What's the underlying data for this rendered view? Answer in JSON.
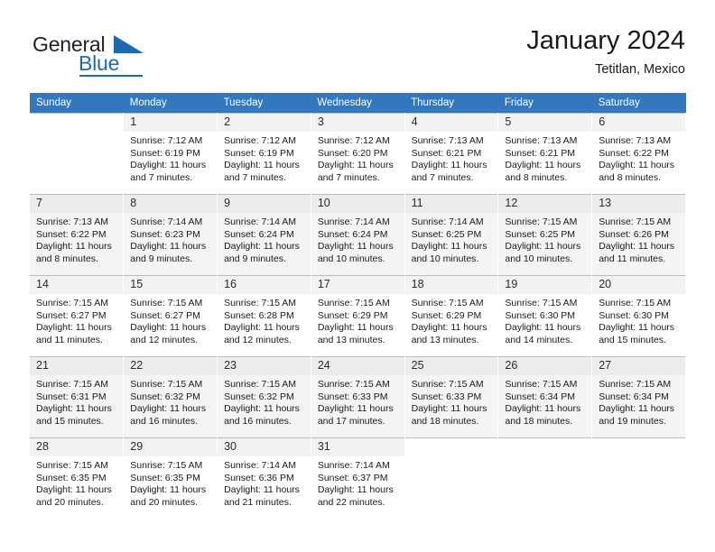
{
  "logo": {
    "word1": "General",
    "word2": "Blue",
    "triangle_color": "#1f69b0",
    "text_color": "#231f20"
  },
  "header": {
    "title": "January 2024",
    "subtitle": "Tetitlan, Mexico",
    "header_bg": "#3377bd"
  },
  "weekdays": [
    "Sunday",
    "Monday",
    "Tuesday",
    "Wednesday",
    "Thursday",
    "Friday",
    "Saturday"
  ],
  "weeks": [
    [
      {
        "day": "",
        "lines": [
          "",
          "",
          "",
          ""
        ]
      },
      {
        "day": "1",
        "lines": [
          "Sunrise: 7:12 AM",
          "Sunset: 6:19 PM",
          "Daylight: 11 hours",
          "and 7 minutes."
        ]
      },
      {
        "day": "2",
        "lines": [
          "Sunrise: 7:12 AM",
          "Sunset: 6:19 PM",
          "Daylight: 11 hours",
          "and 7 minutes."
        ]
      },
      {
        "day": "3",
        "lines": [
          "Sunrise: 7:12 AM",
          "Sunset: 6:20 PM",
          "Daylight: 11 hours",
          "and 7 minutes."
        ]
      },
      {
        "day": "4",
        "lines": [
          "Sunrise: 7:13 AM",
          "Sunset: 6:21 PM",
          "Daylight: 11 hours",
          "and 7 minutes."
        ]
      },
      {
        "day": "5",
        "lines": [
          "Sunrise: 7:13 AM",
          "Sunset: 6:21 PM",
          "Daylight: 11 hours",
          "and 8 minutes."
        ]
      },
      {
        "day": "6",
        "lines": [
          "Sunrise: 7:13 AM",
          "Sunset: 6:22 PM",
          "Daylight: 11 hours",
          "and 8 minutes."
        ]
      }
    ],
    [
      {
        "day": "7",
        "lines": [
          "Sunrise: 7:13 AM",
          "Sunset: 6:22 PM",
          "Daylight: 11 hours",
          "and 8 minutes."
        ]
      },
      {
        "day": "8",
        "lines": [
          "Sunrise: 7:14 AM",
          "Sunset: 6:23 PM",
          "Daylight: 11 hours",
          "and 9 minutes."
        ]
      },
      {
        "day": "9",
        "lines": [
          "Sunrise: 7:14 AM",
          "Sunset: 6:24 PM",
          "Daylight: 11 hours",
          "and 9 minutes."
        ]
      },
      {
        "day": "10",
        "lines": [
          "Sunrise: 7:14 AM",
          "Sunset: 6:24 PM",
          "Daylight: 11 hours",
          "and 10 minutes."
        ]
      },
      {
        "day": "11",
        "lines": [
          "Sunrise: 7:14 AM",
          "Sunset: 6:25 PM",
          "Daylight: 11 hours",
          "and 10 minutes."
        ]
      },
      {
        "day": "12",
        "lines": [
          "Sunrise: 7:15 AM",
          "Sunset: 6:25 PM",
          "Daylight: 11 hours",
          "and 10 minutes."
        ]
      },
      {
        "day": "13",
        "lines": [
          "Sunrise: 7:15 AM",
          "Sunset: 6:26 PM",
          "Daylight: 11 hours",
          "and 11 minutes."
        ]
      }
    ],
    [
      {
        "day": "14",
        "lines": [
          "Sunrise: 7:15 AM",
          "Sunset: 6:27 PM",
          "Daylight: 11 hours",
          "and 11 minutes."
        ]
      },
      {
        "day": "15",
        "lines": [
          "Sunrise: 7:15 AM",
          "Sunset: 6:27 PM",
          "Daylight: 11 hours",
          "and 12 minutes."
        ]
      },
      {
        "day": "16",
        "lines": [
          "Sunrise: 7:15 AM",
          "Sunset: 6:28 PM",
          "Daylight: 11 hours",
          "and 12 minutes."
        ]
      },
      {
        "day": "17",
        "lines": [
          "Sunrise: 7:15 AM",
          "Sunset: 6:29 PM",
          "Daylight: 11 hours",
          "and 13 minutes."
        ]
      },
      {
        "day": "18",
        "lines": [
          "Sunrise: 7:15 AM",
          "Sunset: 6:29 PM",
          "Daylight: 11 hours",
          "and 13 minutes."
        ]
      },
      {
        "day": "19",
        "lines": [
          "Sunrise: 7:15 AM",
          "Sunset: 6:30 PM",
          "Daylight: 11 hours",
          "and 14 minutes."
        ]
      },
      {
        "day": "20",
        "lines": [
          "Sunrise: 7:15 AM",
          "Sunset: 6:30 PM",
          "Daylight: 11 hours",
          "and 15 minutes."
        ]
      }
    ],
    [
      {
        "day": "21",
        "lines": [
          "Sunrise: 7:15 AM",
          "Sunset: 6:31 PM",
          "Daylight: 11 hours",
          "and 15 minutes."
        ]
      },
      {
        "day": "22",
        "lines": [
          "Sunrise: 7:15 AM",
          "Sunset: 6:32 PM",
          "Daylight: 11 hours",
          "and 16 minutes."
        ]
      },
      {
        "day": "23",
        "lines": [
          "Sunrise: 7:15 AM",
          "Sunset: 6:32 PM",
          "Daylight: 11 hours",
          "and 16 minutes."
        ]
      },
      {
        "day": "24",
        "lines": [
          "Sunrise: 7:15 AM",
          "Sunset: 6:33 PM",
          "Daylight: 11 hours",
          "and 17 minutes."
        ]
      },
      {
        "day": "25",
        "lines": [
          "Sunrise: 7:15 AM",
          "Sunset: 6:33 PM",
          "Daylight: 11 hours",
          "and 18 minutes."
        ]
      },
      {
        "day": "26",
        "lines": [
          "Sunrise: 7:15 AM",
          "Sunset: 6:34 PM",
          "Daylight: 11 hours",
          "and 18 minutes."
        ]
      },
      {
        "day": "27",
        "lines": [
          "Sunrise: 7:15 AM",
          "Sunset: 6:34 PM",
          "Daylight: 11 hours",
          "and 19 minutes."
        ]
      }
    ],
    [
      {
        "day": "28",
        "lines": [
          "Sunrise: 7:15 AM",
          "Sunset: 6:35 PM",
          "Daylight: 11 hours",
          "and 20 minutes."
        ]
      },
      {
        "day": "29",
        "lines": [
          "Sunrise: 7:15 AM",
          "Sunset: 6:35 PM",
          "Daylight: 11 hours",
          "and 20 minutes."
        ]
      },
      {
        "day": "30",
        "lines": [
          "Sunrise: 7:14 AM",
          "Sunset: 6:36 PM",
          "Daylight: 11 hours",
          "and 21 minutes."
        ]
      },
      {
        "day": "31",
        "lines": [
          "Sunrise: 7:14 AM",
          "Sunset: 6:37 PM",
          "Daylight: 11 hours",
          "and 22 minutes."
        ]
      },
      {
        "day": "",
        "lines": [
          "",
          "",
          "",
          ""
        ]
      },
      {
        "day": "",
        "lines": [
          "",
          "",
          "",
          ""
        ]
      },
      {
        "day": "",
        "lines": [
          "",
          "",
          "",
          ""
        ]
      }
    ]
  ]
}
